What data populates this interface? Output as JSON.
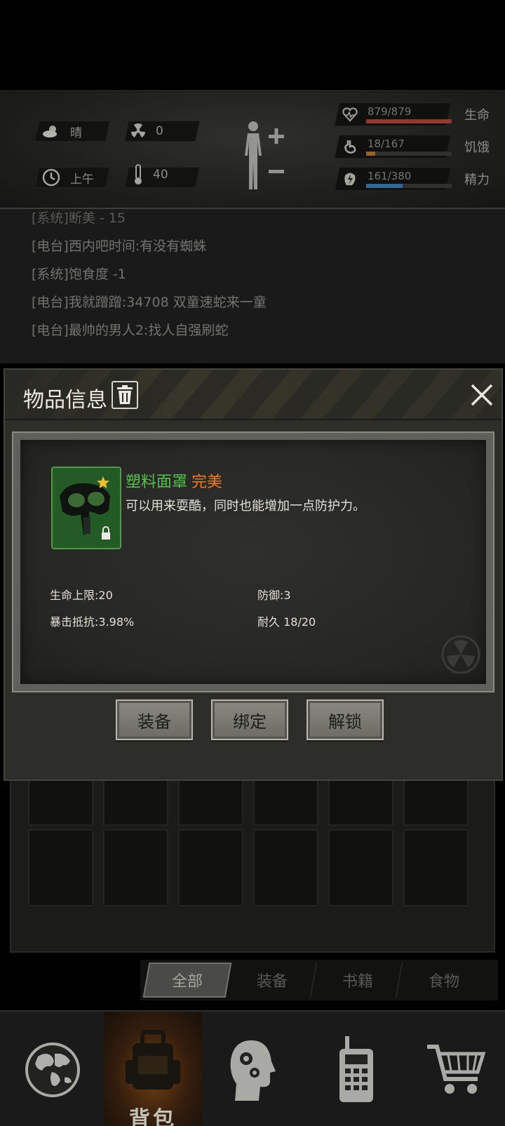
{
  "status": {
    "weather": "晴",
    "radiation": "0",
    "time_of_day": "上午",
    "temperature": "40",
    "bars": [
      {
        "text": "879/879",
        "label": "生命",
        "fraction": 1.0,
        "color": "#b0473a",
        "icon": "heart-icon"
      },
      {
        "text": "18/167",
        "label": "饥饿",
        "fraction": 0.108,
        "color": "#b7772e",
        "icon": "stomach-icon"
      },
      {
        "text": "161/380",
        "label": "精力",
        "fraction": 0.424,
        "color": "#3f7fb8",
        "icon": "energy-icon"
      }
    ]
  },
  "log": [
    "[系统]断美 - 15",
    "[电台]西内吧时间:有没有蜘蛛",
    "[系统]饱食度 -1",
    "[电台]我就蹭蹭:34708 双童速蛇来一童",
    "[电台]最帅的男人2:找人自强刷蛇"
  ],
  "modal": {
    "title": "物品信息",
    "item_name": "塑料面罩",
    "item_quality": "完美",
    "item_desc": "可以用来耍酷，同时也能增加一点防护力。",
    "stats": [
      "生命上限:20",
      "防御:3",
      "暴击抵抗:3.98%",
      "耐久 18/20"
    ],
    "buttons": [
      "装备",
      "绑定",
      "解锁"
    ]
  },
  "filter_tabs": [
    "全部",
    "装备",
    "书籍",
    "食物"
  ],
  "nav": {
    "active_label": "背包"
  }
}
